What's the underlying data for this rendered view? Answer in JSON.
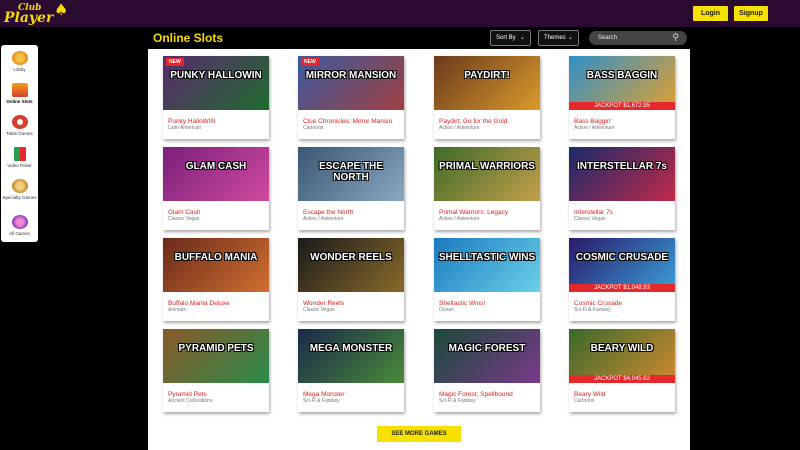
{
  "brand": {
    "logo_line1": "Club",
    "logo_line2": "Player"
  },
  "header": {
    "login_label": "Login",
    "signup_label": "Signup"
  },
  "sidebar": {
    "items": [
      {
        "label": "Lobby",
        "icon": "lobby-icon",
        "color": "#e88a1a"
      },
      {
        "label": "Online Slots",
        "icon": "slots-icon",
        "color": "#f2a01c"
      },
      {
        "label": "Table Games",
        "icon": "table-games-icon",
        "color": "#d8402e"
      },
      {
        "label": "Video Poker",
        "icon": "video-poker-icon",
        "color": "#2a9d4e"
      },
      {
        "label": "Specialty Games",
        "icon": "specialty-icon",
        "color": "#c98a2a"
      },
      {
        "label": "All Games",
        "icon": "all-games-icon",
        "color": "#c83c8c"
      }
    ]
  },
  "main": {
    "title": "Online Slots",
    "sort_label": "Sort By",
    "themes_label": "Themes",
    "search_placeholder": "Search",
    "more_button_label": "SEE MORE GAMES"
  },
  "games": [
    {
      "name": "Punky HalloWIN",
      "category": "Latin American",
      "thumb_text": "PUNKY HALLOWIN",
      "badge": "NEW",
      "jackpot": "",
      "bg": "#5b2a6e",
      "bg2": "#1f6b2f"
    },
    {
      "name": "Clue Chronicles: Mirror Mansio",
      "category": "Cartoons",
      "thumb_text": "MIRROR MANSION",
      "badge": "NEW",
      "jackpot": "",
      "bg": "#3b5aa0",
      "bg2": "#a04040"
    },
    {
      "name": "Paydirt: Go for the Gold",
      "category": "Action / Adventure",
      "thumb_text": "PAYDIRT!",
      "badge": "",
      "jackpot": "",
      "bg": "#6b3a1c",
      "bg2": "#d99a2b"
    },
    {
      "name": "Bass Baggin'",
      "category": "Action / Adventure",
      "thumb_text": "BASS BAGGIN",
      "badge": "",
      "jackpot": "JACKPOT $1,672.95",
      "bg": "#2f8fc8",
      "bg2": "#e0a030"
    },
    {
      "name": "Glam Cash",
      "category": "Classic Vegas",
      "thumb_text": "GLAM CASH",
      "badge": "",
      "jackpot": "",
      "bg": "#7a1f7a",
      "bg2": "#d04aa0"
    },
    {
      "name": "Escape the North",
      "category": "Action / Adventure",
      "thumb_text": "ESCAPE THE NORTH",
      "badge": "",
      "jackpot": "",
      "bg": "#3a5672",
      "bg2": "#8aa8c0"
    },
    {
      "name": "Primal Warriors: Legacy",
      "category": "Action / Adventure",
      "thumb_text": "PRIMAL WARRIORS",
      "badge": "",
      "jackpot": "",
      "bg": "#3e6a2a",
      "bg2": "#c2a04a"
    },
    {
      "name": "Interstellar 7s",
      "category": "Classic Vegas",
      "thumb_text": "INTERSTELLAR 7s",
      "badge": "",
      "jackpot": "",
      "bg": "#1a2a6a",
      "bg2": "#c02a4a"
    },
    {
      "name": "Buffalo Mania Deluxe",
      "category": "Animals",
      "thumb_text": "BUFFALO MANIA",
      "badge": "",
      "jackpot": "",
      "bg": "#6a2a1a",
      "bg2": "#d07030"
    },
    {
      "name": "Wonder Reels",
      "category": "Classic Vegas",
      "thumb_text": "WONDER REELS",
      "badge": "",
      "jackpot": "",
      "bg": "#1a1a1a",
      "bg2": "#8a6a2a"
    },
    {
      "name": "Sheltastic Wins!",
      "category": "Ocean",
      "thumb_text": "SHELLTASTIC WINS",
      "badge": "",
      "jackpot": "",
      "bg": "#1a7ac0",
      "bg2": "#6ad0e8"
    },
    {
      "name": "Cosmic Crusade",
      "category": "Sci-Fi & Fantasy",
      "thumb_text": "COSMIC CRUSADE",
      "badge": "",
      "jackpot": "JACKPOT $1,048.93",
      "bg": "#2a1a6a",
      "bg2": "#3aa0d8"
    },
    {
      "name": "Pyramid Pets",
      "category": "Ancient Civilizations",
      "thumb_text": "PYRAMID PETS",
      "badge": "",
      "jackpot": "",
      "bg": "#8a5a2a",
      "bg2": "#2a8a4a"
    },
    {
      "name": "Mega Monster",
      "category": "Sci-Fi & Fantasy",
      "thumb_text": "MEGA MONSTER",
      "badge": "",
      "jackpot": "",
      "bg": "#1a2a4a",
      "bg2": "#4a8a3a"
    },
    {
      "name": "Magic Forest: Spellbound",
      "category": "Sci-Fi & Fantasy",
      "thumb_text": "MAGIC FOREST",
      "badge": "",
      "jackpot": "",
      "bg": "#1a4a3a",
      "bg2": "#7a3a8a"
    },
    {
      "name": "Beary Wild",
      "category": "Cartoons",
      "thumb_text": "BEARY WILD",
      "badge": "",
      "jackpot": "JACKPOT $4,045.62",
      "bg": "#3a6a2a",
      "bg2": "#d08a30"
    }
  ]
}
